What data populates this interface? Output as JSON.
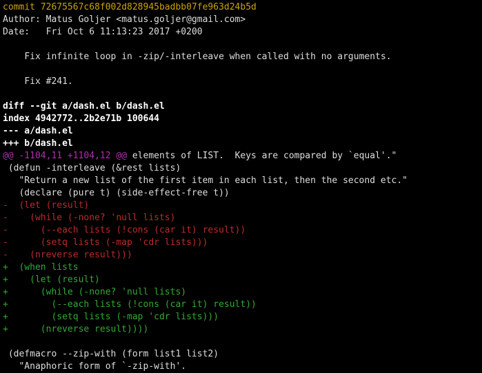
{
  "commit_label": "commit",
  "commit_hash": "72675567c68f002d828945badbb07fe963d24b5d",
  "author_label": "Author:",
  "author_value": "Matus Goljer <matus.goljer@gmail.com>",
  "date_label": "Date:",
  "date_value": "Fri Oct 6 11:13:23 2017 +0200",
  "msg1": "Fix infinite loop in -zip/-interleave when called with no arguments.",
  "msg2": "Fix #241.",
  "diff_header": "diff --git a/dash.el b/dash.el",
  "index_line": "index 4942772..2b2e71b 100644",
  "minus_file": "--- a/dash.el",
  "plus_file": "+++ b/dash.el",
  "hunk_at1": "@@",
  "hunk_range": " -1104,11 +1104,12 ",
  "hunk_at2": "@@",
  "hunk_ctx": " elements of LIST.  Keys are compared by `equal'.\"",
  "ctx1": " (defun -interleave (&rest lists)",
  "ctx2": "   \"Return a new list of the first item in each list, then the second etc.\"",
  "ctx3": "   (declare (pure t) (side-effect-free t))",
  "del1": "-  (let (result)",
  "del2": "-    (while (-none? 'null lists)",
  "del3": "-      (--each lists (!cons (car it) result))",
  "del4": "-      (setq lists (-map 'cdr lists)))",
  "del5": "-    (nreverse result)))",
  "add1": "+  (when lists",
  "add2": "+    (let (result)",
  "add3": "+      (while (-none? 'null lists)",
  "add4": "+        (--each lists (!cons (car it) result))",
  "add5": "+        (setq lists (-map 'cdr lists)))",
  "add6": "+      (nreverse result))))",
  "ctx4": " (defmacro --zip-with (form list1 list2)",
  "ctx5": "   \"Anaphoric form of `-zip-with'."
}
